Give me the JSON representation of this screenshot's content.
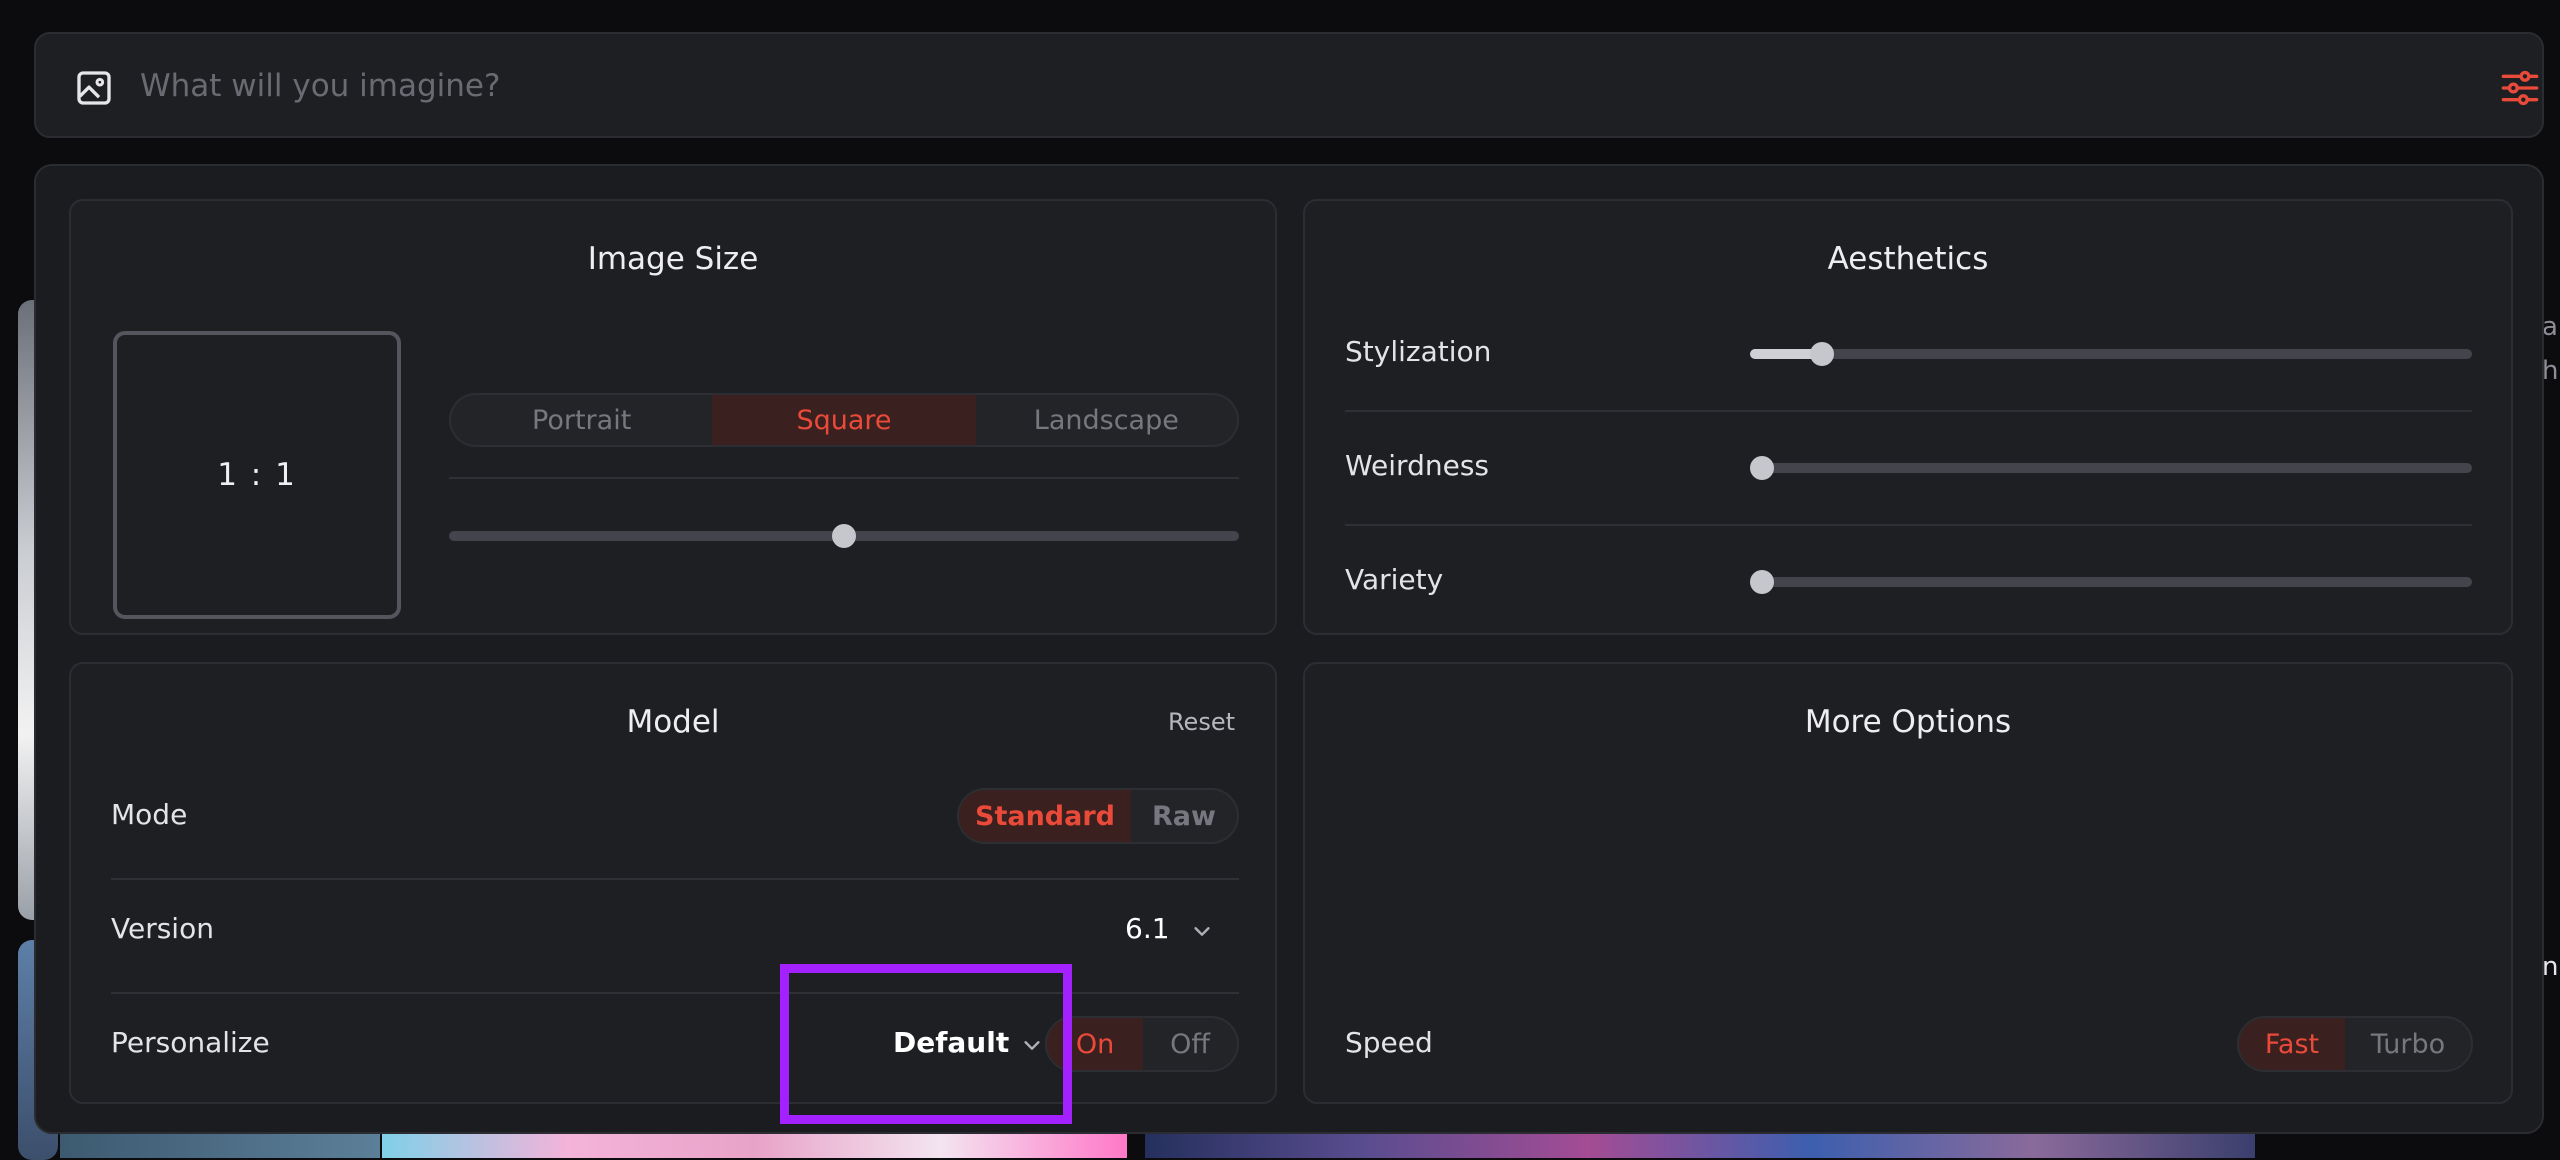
{
  "prompt": {
    "placeholder": "What will you imagine?",
    "value": "",
    "accent": "#ea4a3a"
  },
  "image_size": {
    "title": "Image Size",
    "aspect_label": "1 : 1",
    "orientation_options": [
      "Portrait",
      "Square",
      "Landscape"
    ],
    "selected_orientation": "Square",
    "aspect_slider_fraction": 0.5
  },
  "aesthetics": {
    "title": "Aesthetics",
    "sliders": [
      {
        "label": "Stylization",
        "fraction": 0.1
      },
      {
        "label": "Weirdness",
        "fraction": 0.0
      },
      {
        "label": "Variety",
        "fraction": 0.0
      }
    ]
  },
  "model": {
    "title": "Model",
    "reset_label": "Reset",
    "mode_label": "Mode",
    "mode_options": [
      "Standard",
      "Raw"
    ],
    "selected_mode": "Standard",
    "version_label": "Version",
    "version_value": "6.1",
    "personalize_label": "Personalize",
    "personalize_profile": "Default",
    "personalize_options": [
      "On",
      "Off"
    ],
    "selected_personalize": "On"
  },
  "more_options": {
    "title": "More Options",
    "speed_label": "Speed",
    "speed_options": [
      "Fast",
      "Turbo"
    ],
    "selected_speed": "Fast"
  },
  "edge_text": [
    "a",
    "h",
    "n"
  ],
  "colors": {
    "accent": "#ea4a3a",
    "highlight": "#a321ff",
    "panel": "#1b1c20",
    "card": "#1e1f23"
  }
}
